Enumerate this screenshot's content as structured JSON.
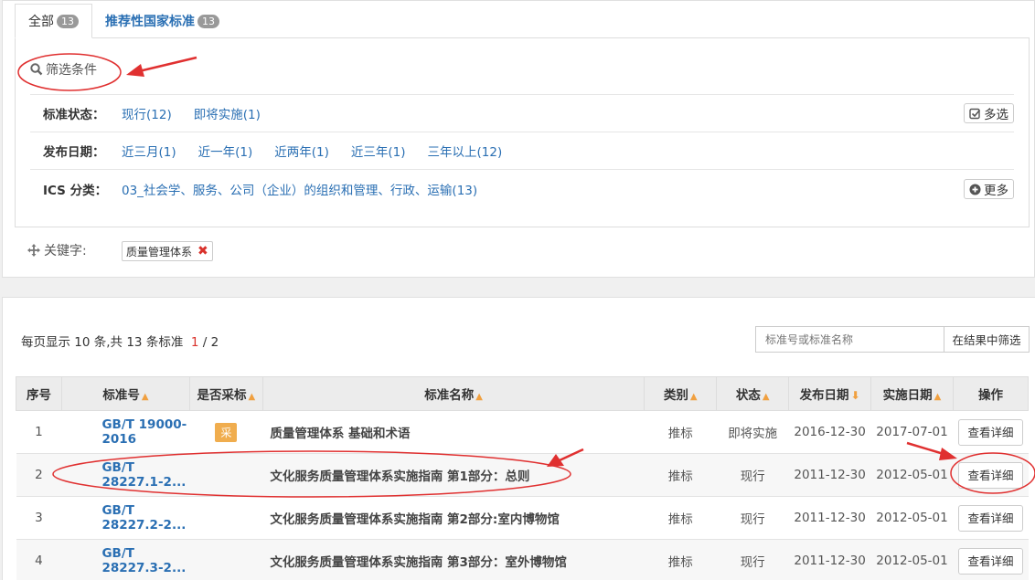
{
  "tabs": [
    {
      "label": "全部",
      "count": "13"
    },
    {
      "label": "推荐性国家标准",
      "count": "13"
    }
  ],
  "filter": {
    "title": "筛选条件",
    "rows": [
      {
        "label": "标准状态：",
        "options": [
          "现行(12)",
          "即将实施(1)"
        ],
        "button": "多选"
      },
      {
        "label": "发布日期：",
        "options": [
          "近三月(1)",
          "近一年(1)",
          "近两年(1)",
          "近三年(1)",
          "三年以上(12)"
        ]
      },
      {
        "label": "ICS 分类：",
        "options": [
          "03_社会学、服务、公司（企业）的组织和管理、行政、运输(13)"
        ],
        "button": "更多"
      }
    ]
  },
  "keyword": {
    "label": "关键字:",
    "tag": "质量管理体系"
  },
  "pagination": {
    "prefix": "每页显示 10 条,共 13 条标准",
    "current": "1",
    "sep": " / ",
    "total": "2"
  },
  "search": {
    "placeholder": "标准号或标准名称",
    "button": "在结果中筛选"
  },
  "table": {
    "headers": [
      "序号",
      "标准号",
      "是否采标",
      "标准名称",
      "类别",
      "状态",
      "发布日期",
      "实施日期",
      "操作"
    ],
    "rows": [
      {
        "no": "1",
        "code": "GB/T 19000-2016",
        "adopted": "采",
        "name": "质量管理体系 基础和术语",
        "type": "推标",
        "status": "即将实施",
        "pub": "2016-12-30",
        "impl": "2017-07-01",
        "action": "查看详细"
      },
      {
        "no": "2",
        "code": "GB/T 28227.1-2...",
        "adopted": "",
        "name": "文化服务质量管理体系实施指南 第1部分：总则",
        "type": "推标",
        "status": "现行",
        "pub": "2011-12-30",
        "impl": "2012-05-01",
        "action": "查看详细"
      },
      {
        "no": "3",
        "code": "GB/T 28227.2-2...",
        "adopted": "",
        "name": "文化服务质量管理体系实施指南 第2部分:室内博物馆",
        "type": "推标",
        "status": "现行",
        "pub": "2011-12-30",
        "impl": "2012-05-01",
        "action": "查看详细"
      },
      {
        "no": "4",
        "code": "GB/T 28227.3-2...",
        "adopted": "",
        "name": "文化服务质量管理体系实施指南 第3部分：室外博物馆",
        "type": "推标",
        "status": "现行",
        "pub": "2011-12-30",
        "impl": "2012-05-01",
        "action": "查看详细"
      }
    ]
  },
  "colors": {
    "link": "#2a6fb3",
    "annotation": "#e03030",
    "badge": "#f0ad4e"
  }
}
